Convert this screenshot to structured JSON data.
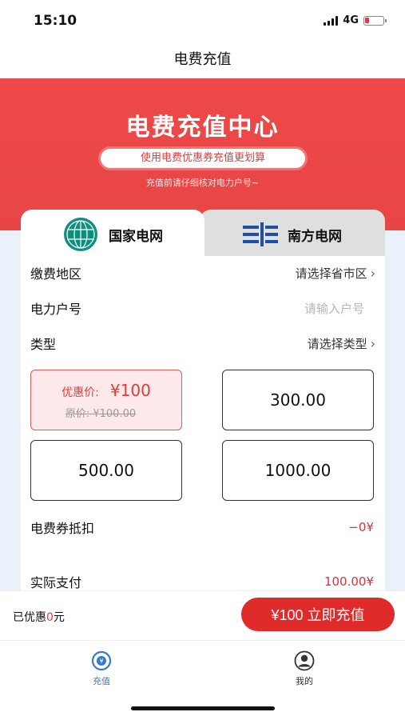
{
  "status_bar": {
    "time": "15:10",
    "network": "4G"
  },
  "nav": {
    "title": "电费充值"
  },
  "hero": {
    "title": "电费充值中心",
    "pill": "使用电费优惠券充值更划算",
    "note": "充值前请仔细核对电力户号~"
  },
  "tabs": [
    {
      "label": "国家电网",
      "icon": "state-grid-logo-icon",
      "active": true
    },
    {
      "label": "南方电网",
      "icon": "china-southern-grid-logo-icon",
      "active": false
    }
  ],
  "form": {
    "region": {
      "label": "缴费地区",
      "value": "请选择省市区"
    },
    "account": {
      "label": "电力户号",
      "placeholder": "请输入户号"
    },
    "type": {
      "label": "类型",
      "value": "请选择类型"
    }
  },
  "amounts": {
    "selected": {
      "promo_label": "优惠价:",
      "promo_price": "¥100",
      "original": "原价: ¥100.00"
    },
    "options": [
      "300.00",
      "500.00",
      "1000.00"
    ]
  },
  "coupon": {
    "label": "电费券抵扣",
    "value": "−0¥"
  },
  "actual_pay": {
    "label": "实际支付",
    "value": "100.00¥"
  },
  "bottom": {
    "saved_prefix": "已优惠",
    "saved_amount": "0",
    "saved_suffix": "元",
    "button_label": "¥100 立即充值"
  },
  "tabbar": [
    {
      "label": "充值",
      "icon": "recharge-icon",
      "active": true,
      "color": "#3a78c9"
    },
    {
      "label": "我的",
      "icon": "user-icon",
      "active": false,
      "color": "#333333"
    }
  ],
  "colors": {
    "accent_red": "#e02b2b",
    "hero_red": "#ee4949",
    "selected_bg": "#fde9e9",
    "tab_blue": "#3a78c9"
  }
}
